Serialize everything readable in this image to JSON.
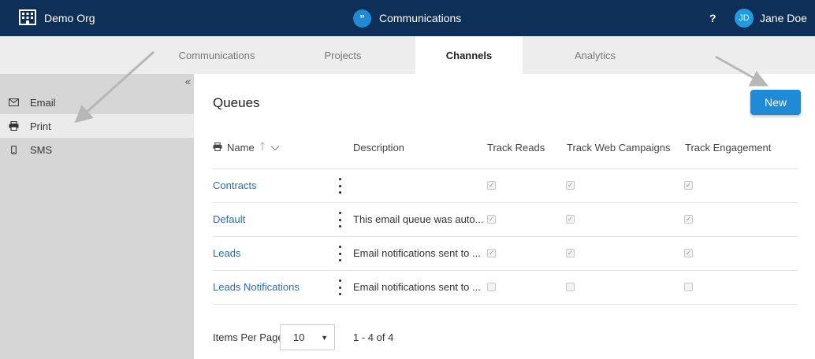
{
  "topbar": {
    "org_name": "Demo Org",
    "app_name": "Communications",
    "help_label": "?",
    "user_initials": "JD",
    "user_name": "Jane Doe"
  },
  "tabs": [
    {
      "label": "Communications",
      "active": false
    },
    {
      "label": "Projects",
      "active": false
    },
    {
      "label": "Channels",
      "active": true
    },
    {
      "label": "Analytics",
      "active": false
    }
  ],
  "sidebar": {
    "collapse_icon": "«",
    "items": [
      {
        "label": "Email",
        "icon": "envelope-icon",
        "active": false
      },
      {
        "label": "Print",
        "icon": "printer-icon",
        "active": true
      },
      {
        "label": "SMS",
        "icon": "mobile-phone-icon",
        "active": false
      }
    ]
  },
  "main": {
    "title": "Queues",
    "new_button": "New",
    "columns": [
      "Name",
      "Description",
      "Track Reads",
      "Track Web Campaigns",
      "Track Engagement"
    ],
    "rows": [
      {
        "name": "Contracts",
        "description": "",
        "track_reads": true,
        "track_web": true,
        "track_engagement": true
      },
      {
        "name": "Default",
        "description": "This email queue was auto...",
        "track_reads": true,
        "track_web": true,
        "track_engagement": true
      },
      {
        "name": "Leads",
        "description": "Email notifications sent to ...",
        "track_reads": true,
        "track_web": true,
        "track_engagement": true
      },
      {
        "name": "Leads Notifications",
        "description": "Email notifications sent to ...",
        "track_reads": false,
        "track_web": false,
        "track_engagement": false
      }
    ],
    "pagination": {
      "items_per_page_label": "Items Per Page",
      "items_per_page_value": "10",
      "range": "1 - 4 of 4"
    }
  },
  "colors": {
    "topbar_bg": "#0e2f57",
    "accent": "#1f8bd6",
    "link": "#2a6db4",
    "sidebar_bg": "#d6d6d6"
  }
}
